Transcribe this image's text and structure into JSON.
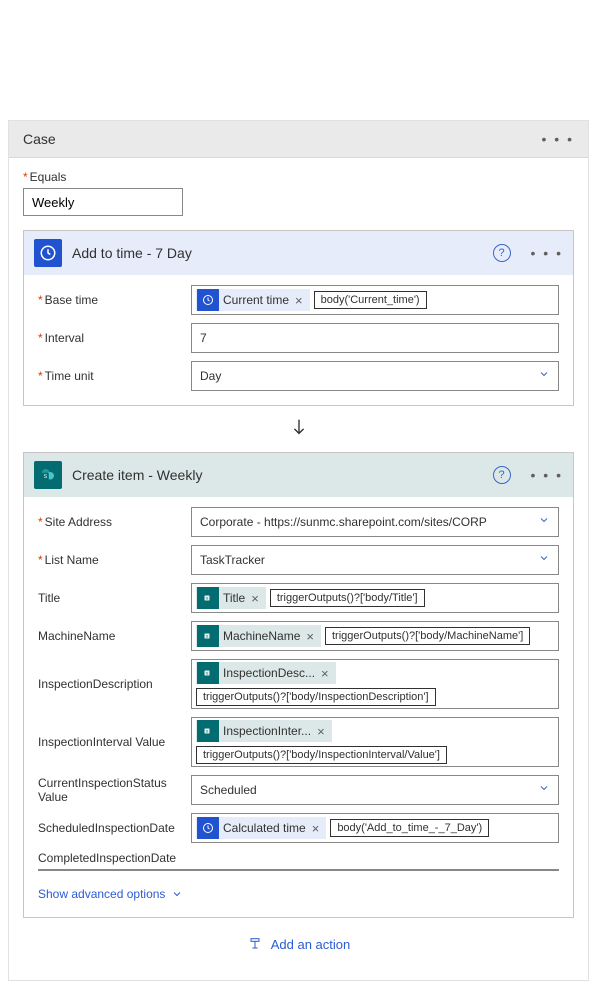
{
  "case": {
    "title": "Case",
    "equals_label": "Equals",
    "equals_value": "Weekly"
  },
  "addTime": {
    "title": "Add to time - 7 Day",
    "baseTime": {
      "label": "Base time",
      "tokenName": "Current time",
      "expr": "body('Current_time')"
    },
    "interval": {
      "label": "Interval",
      "value": "7"
    },
    "timeUnit": {
      "label": "Time unit",
      "value": "Day"
    }
  },
  "createItem": {
    "title": "Create item - Weekly",
    "siteAddress": {
      "label": "Site Address",
      "value": "Corporate - https://sunmc.sharepoint.com/sites/CORP"
    },
    "listName": {
      "label": "List Name",
      "value": "TaskTracker"
    },
    "titleField": {
      "label": "Title",
      "tokenName": "Title",
      "expr": "triggerOutputs()?['body/Title']"
    },
    "machineName": {
      "label": "MachineName",
      "tokenName": "MachineName",
      "expr": "triggerOutputs()?['body/MachineName']"
    },
    "inspectionDescription": {
      "label": "InspectionDescription",
      "tokenName": "InspectionDesc...",
      "expr": "triggerOutputs()?['body/InspectionDescription']"
    },
    "inspectionInterval": {
      "label": "InspectionInterval Value",
      "tokenName": "InspectionInter...",
      "expr": "triggerOutputs()?['body/InspectionInterval/Value']"
    },
    "currentStatus": {
      "label": "CurrentInspectionStatus Value",
      "value": "Scheduled"
    },
    "scheduledDate": {
      "label": "ScheduledInspectionDate",
      "tokenName": "Calculated time",
      "expr": "body('Add_to_time_-_7_Day')"
    },
    "completedDate": {
      "label": "CompletedInspectionDate"
    },
    "showAdvanced": "Show advanced options"
  },
  "addAction": "Add an action"
}
